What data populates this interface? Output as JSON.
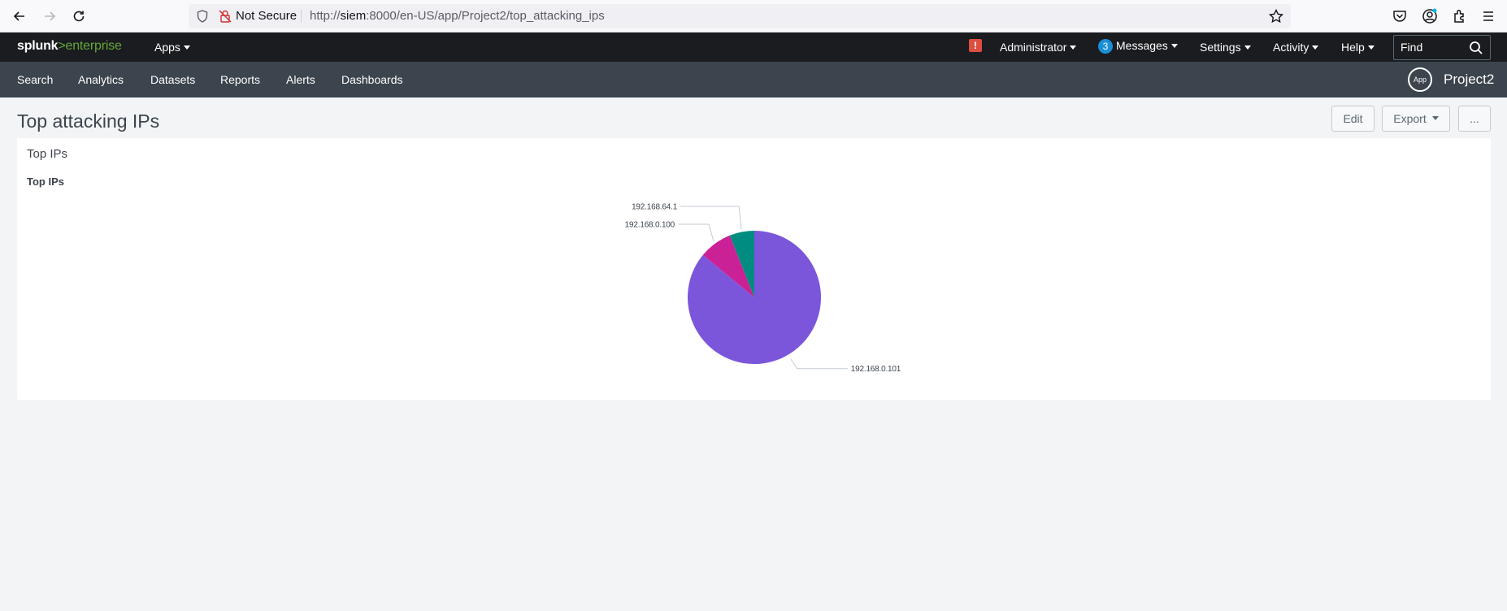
{
  "browser": {
    "not_secure": "Not Secure",
    "url_prefix": "http://",
    "url_host": "siem",
    "url_rest": ":8000/en-US/app/Project2/top_attacking_ips"
  },
  "topbar": {
    "logo_splunk": "splunk",
    "logo_gt": ">",
    "logo_enterprise": "enterprise",
    "apps": "Apps",
    "alert": "!",
    "administrator": "Administrator",
    "messages_count": "3",
    "messages": "Messages",
    "settings": "Settings",
    "activity": "Activity",
    "help": "Help",
    "find_placeholder": "Find"
  },
  "appbar": {
    "nav": [
      "Search",
      "Analytics",
      "Datasets",
      "Reports",
      "Alerts",
      "Dashboards"
    ],
    "app_badge": "App",
    "app_name": "Project2"
  },
  "dashboard": {
    "title": "Top attacking IPs",
    "edit": "Edit",
    "export": "Export",
    "more": "...",
    "panel_title": "Top IPs",
    "viz_title": "Top IPs"
  },
  "chart_data": {
    "type": "pie",
    "title": "Top IPs",
    "categories": [
      "192.168.0.101",
      "192.168.0.100",
      "192.168.64.1"
    ],
    "values": [
      86,
      8,
      6
    ],
    "colors": [
      "#7b56db",
      "#cb2196",
      "#008c80"
    ]
  }
}
